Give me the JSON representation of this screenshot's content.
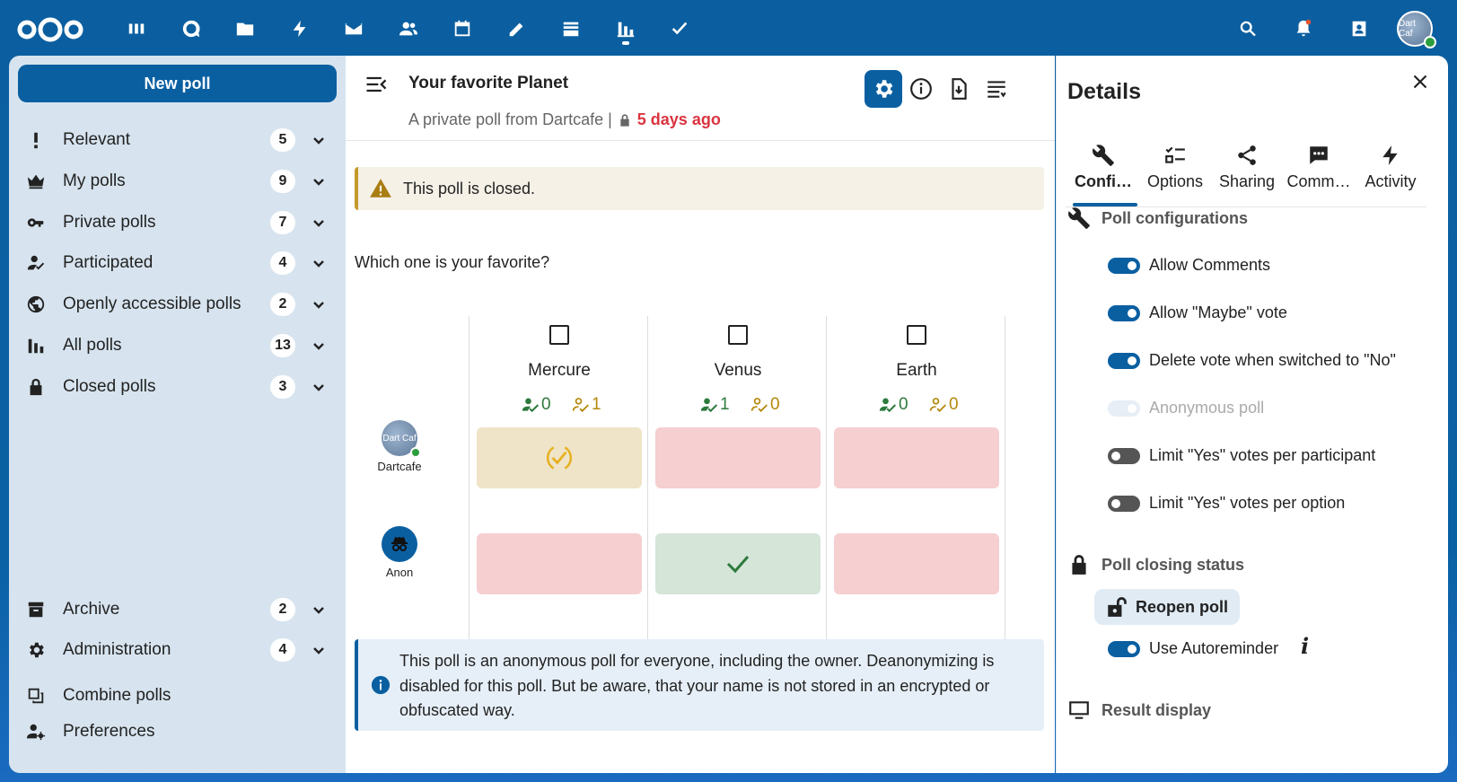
{
  "header": {
    "apps": [
      "dashboard-icon",
      "talk-icon",
      "files-icon",
      "activity-icon",
      "mail-icon",
      "contacts-icon",
      "calendar-icon",
      "notes-icon",
      "deck-icon",
      "polls-icon",
      "tasks-icon"
    ],
    "user_initials": "Dart Caf"
  },
  "sidebar": {
    "new_poll": "New poll",
    "items": [
      {
        "label": "Relevant",
        "count": "5",
        "icon": "exclamation-icon"
      },
      {
        "label": "My polls",
        "count": "9",
        "icon": "crown-icon"
      },
      {
        "label": "Private polls",
        "count": "7",
        "icon": "key-icon"
      },
      {
        "label": "Participated",
        "count": "4",
        "icon": "user-check-icon"
      },
      {
        "label": "Openly accessible polls",
        "count": "2",
        "icon": "globe-icon"
      },
      {
        "label": "All polls",
        "count": "13",
        "icon": "bar-chart-icon"
      },
      {
        "label": "Closed polls",
        "count": "3",
        "icon": "lock-icon"
      }
    ],
    "archive": {
      "label": "Archive",
      "count": "2"
    },
    "administration": {
      "label": "Administration",
      "count": "4"
    },
    "combine": "Combine polls",
    "preferences": "Preferences"
  },
  "main": {
    "title": "Your favorite Planet",
    "subtitle": "A private poll from Dartcafe |",
    "ago": "5 days ago",
    "closed_notice": "This poll is closed.",
    "question": "Which one is your favorite?",
    "options": [
      {
        "name": "Mercure",
        "yes": "0",
        "maybe": "1"
      },
      {
        "name": "Venus",
        "yes": "1",
        "maybe": "0"
      },
      {
        "name": "Earth",
        "yes": "0",
        "maybe": "0"
      }
    ],
    "participants": [
      {
        "name": "Dartcafe",
        "avatar_text": "Dart Caf",
        "votes": [
          "maybe",
          "no",
          "no"
        ]
      },
      {
        "name": "Anon",
        "avatar_text": "",
        "votes": [
          "no",
          "yes",
          "no"
        ]
      }
    ],
    "anon_notice": "This poll is an anonymous poll for everyone, including the owner. Deanonymizing is disabled for this poll. But be aware, that your name is not stored in an encrypted or obfuscated way."
  },
  "details": {
    "title": "Details",
    "tabs": [
      "Confi…",
      "Options",
      "Sharing",
      "Comm…",
      "Activity"
    ],
    "sec_config": "Poll configurations",
    "toggles": [
      {
        "label": "Allow Comments",
        "state": "on"
      },
      {
        "label": "Allow \"Maybe\" vote",
        "state": "on"
      },
      {
        "label": "Delete vote when switched to \"No\"",
        "state": "on"
      },
      {
        "label": "Anonymous poll",
        "state": "disabled"
      },
      {
        "label": "Limit \"Yes\" votes per participant",
        "state": "off"
      },
      {
        "label": "Limit \"Yes\" votes per option",
        "state": "off"
      }
    ],
    "sec_closing": "Poll closing status",
    "reopen": "Reopen poll",
    "autoreminder": "Use Autoreminder",
    "info_glyph": "i",
    "sec_result": "Result display"
  },
  "colors": {
    "primary": "#0a5fa1",
    "yes": "#2d7a3c",
    "maybe": "#b4880d",
    "danger": "#d9343f"
  }
}
